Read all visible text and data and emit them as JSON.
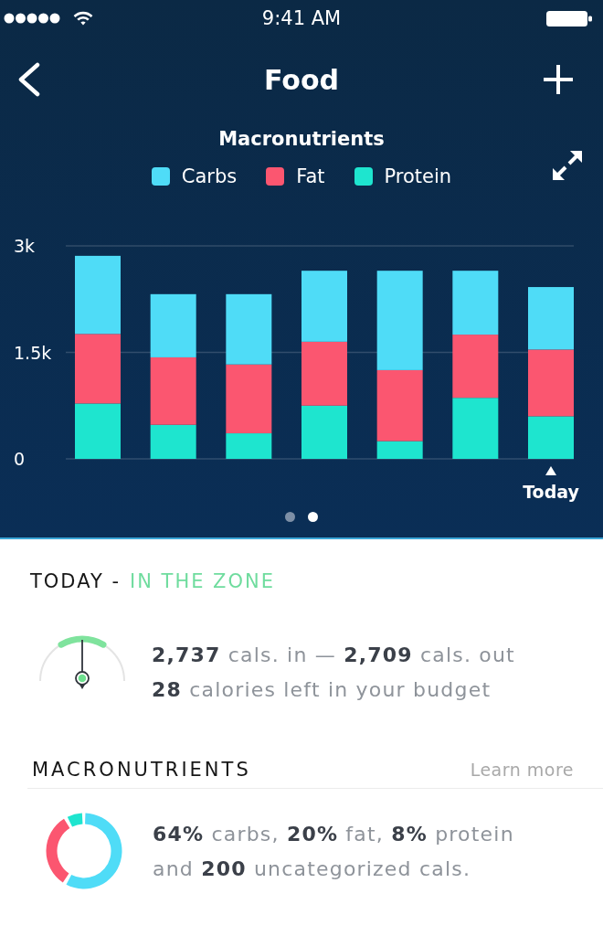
{
  "status_bar": {
    "time": "9:41 AM"
  },
  "nav": {
    "title": "Food"
  },
  "chart_panel": {
    "chart_data": {
      "type": "bar",
      "title": "Macronutrients",
      "legend": "top",
      "stacked": true,
      "ylim": [
        0,
        3000
      ],
      "yticks": [
        0,
        {
          "value": 1500,
          "label": "1.5k"
        },
        {
          "value": 3000,
          "label": "3k"
        }
      ],
      "series": [
        {
          "name": "Carbs",
          "color": "#4fdcf7",
          "values": [
            1100,
            890,
            990,
            1000,
            1400,
            900,
            880
          ]
        },
        {
          "name": "Fat",
          "color": "#fb5670",
          "values": [
            980,
            950,
            970,
            900,
            1000,
            890,
            940
          ]
        },
        {
          "name": "Protein",
          "color": "#1ee5cf",
          "values": [
            780,
            480,
            360,
            750,
            250,
            860,
            600
          ]
        }
      ],
      "annotations": [
        "Today"
      ]
    },
    "pager": [
      {
        "selected": false
      },
      {
        "selected": true
      }
    ]
  },
  "today": {
    "heading": "TODAY -",
    "status": "IN THE ZONE",
    "gauge": {
      "level": 0.5
    },
    "lines": [
      "**2,737** cals. in — **2,709** cals. out",
      "**28** calories left in your budget"
    ]
  },
  "macronutrients": {
    "heading": "MACRONUTRIENTS",
    "link": "Learn more",
    "summary": "**64%** carbs, **20%** fat, **8%** protein and **200** uncategorized cals."
  }
}
